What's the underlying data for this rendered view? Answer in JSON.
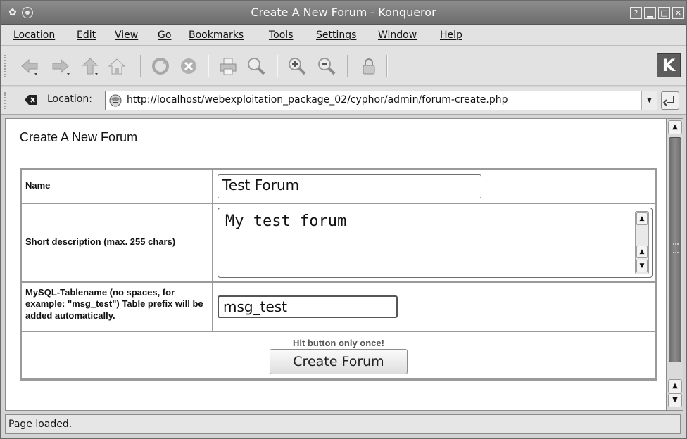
{
  "window": {
    "title": "Create A New Forum - Konqueror"
  },
  "menu": [
    "Location",
    "Edit",
    "View",
    "Go",
    "Bookmarks",
    "Tools",
    "Settings",
    "Window",
    "Help"
  ],
  "location_bar": {
    "label": "Location:",
    "url": "http://localhost/webexploitation_package_02/cyphor/admin/forum-create.php"
  },
  "page": {
    "heading": "Create A New Forum",
    "form": {
      "name_label": "Name",
      "name_value": "Test Forum",
      "desc_label": "Short description (max. 255 chars)",
      "desc_value": "My test forum",
      "table_label": "MySQL-Tablename (no spaces, for example: \"msg_test\") Table prefix will be added automatically.",
      "table_value": "msg_test",
      "hint": "Hit button only once!",
      "submit_label": "Create Forum"
    }
  },
  "status": {
    "text": "Page loaded."
  },
  "brand": {
    "logo_text": "K"
  },
  "icons": {
    "toolbar": [
      "back-icon",
      "forward-icon",
      "up-icon",
      "home-icon",
      "reload-icon",
      "stop-icon",
      "print-icon",
      "find-icon",
      "zoom-in-icon",
      "zoom-out-icon",
      "security-icon"
    ]
  }
}
